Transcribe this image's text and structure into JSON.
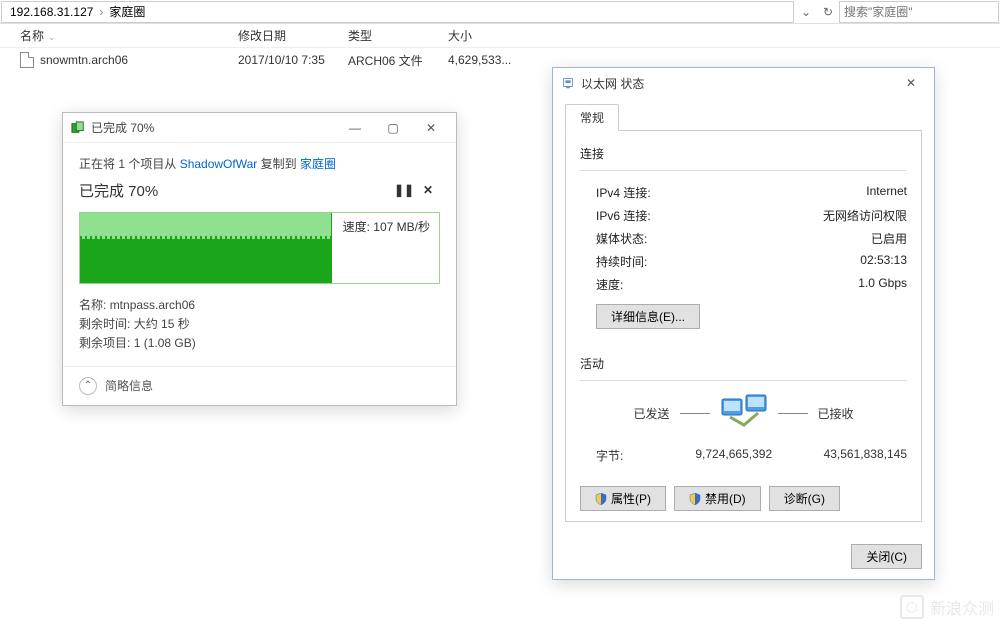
{
  "addressbar": {
    "ip": "192.168.31.127",
    "folder": "家庭圈",
    "search_placeholder": "搜索\"家庭圈\""
  },
  "columns": {
    "name": "名称",
    "date": "修改日期",
    "type": "类型",
    "size": "大小"
  },
  "files": [
    {
      "name": "snowmtn.arch06",
      "date": "2017/10/10 7:35",
      "type": "ARCH06 文件",
      "size": "4,629,533..."
    }
  ],
  "copy": {
    "title": "已完成 70%",
    "line_prefix": "正在将 1 个项目从 ",
    "src": "ShadowOfWar",
    "mid": " 复制到 ",
    "dst": "家庭圈",
    "percent_label": "已完成 70%",
    "speed_prefix": "速度: ",
    "speed_value": "107 MB/秒",
    "progress_fraction": 0.7,
    "meta_name_k": "名称:",
    "meta_name_v": "mtnpass.arch06",
    "meta_time_k": "剩余时间:",
    "meta_time_v": "大约 15 秒",
    "meta_items_k": "剩余项目:",
    "meta_items_v": "1 (1.08 GB)",
    "less": "简略信息"
  },
  "eth": {
    "title": "以太网 状态",
    "tab": "常规",
    "section_conn": "连接",
    "ipv4_k": "IPv4 连接:",
    "ipv4_v": "Internet",
    "ipv6_k": "IPv6 连接:",
    "ipv6_v": "无网络访问权限",
    "media_k": "媒体状态:",
    "media_v": "已启用",
    "dur_k": "持续时间:",
    "dur_v": "02:53:13",
    "spd_k": "速度:",
    "spd_v": "1.0 Gbps",
    "details_btn": "详细信息(E)...",
    "section_act": "活动",
    "sent": "已发送",
    "recv": "已接收",
    "bytes_k": "字节:",
    "bytes_sent": "9,724,665,392",
    "bytes_recv": "43,561,838,145",
    "btn_props": "属性(P)",
    "btn_disable": "禁用(D)",
    "btn_diag": "诊断(G)",
    "btn_close": "关闭(C)"
  },
  "watermark": "新浪众测"
}
